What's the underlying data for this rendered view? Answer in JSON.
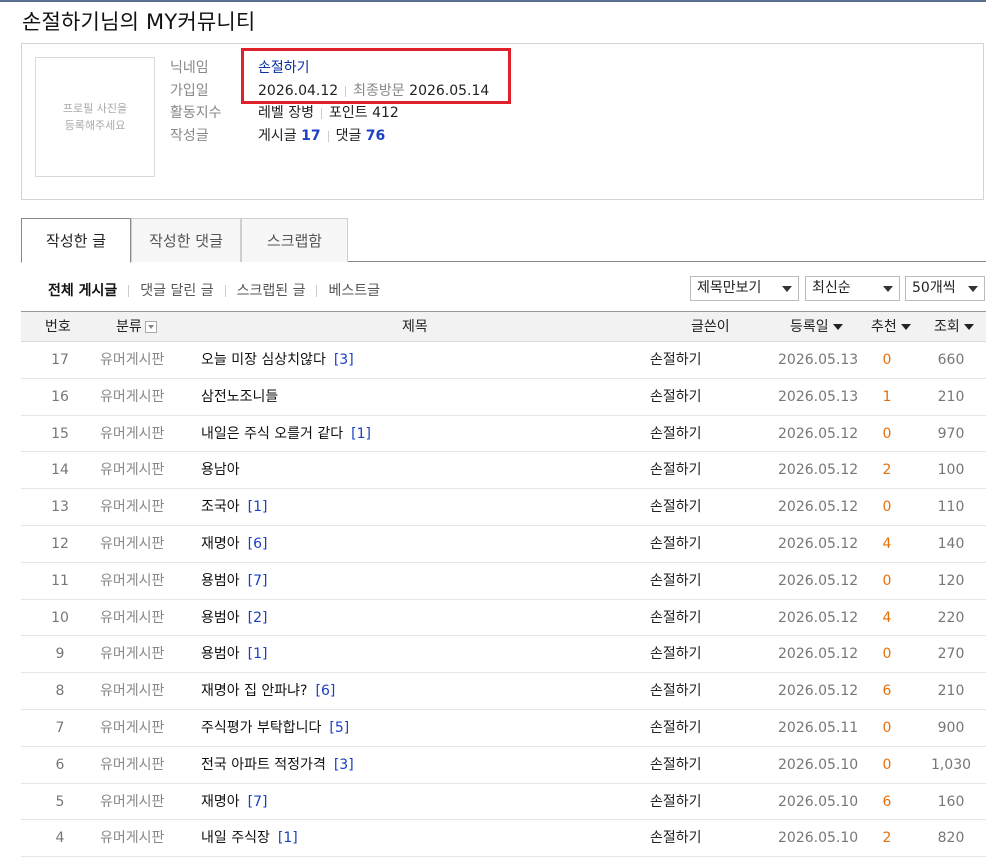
{
  "page": {
    "title": "손절하기님의 MY커뮤니티"
  },
  "profile": {
    "photo_placeholder": "프로필 사진을\n등록해주세요",
    "nickname_label": "닉네임",
    "nickname": "손절하기",
    "join_label": "가입일",
    "join_date": "2026.04.12",
    "last_visit_label": "최종방문",
    "last_visit": "2026.05.14",
    "activity_label": "활동지수",
    "level_text": "레벨 장병",
    "point_label": "포인트",
    "point_value": "412",
    "writings_label": "작성글",
    "posts_label": "게시글",
    "posts_count": "17",
    "comments_label": "댓글",
    "comments_count": "76"
  },
  "tabs": [
    {
      "label": "작성한 글",
      "active": true
    },
    {
      "label": "작성한 댓글",
      "active": false
    },
    {
      "label": "스크랩함",
      "active": false
    }
  ],
  "subnav": [
    {
      "label": "전체 게시글",
      "active": true
    },
    {
      "label": "댓글 달린 글",
      "active": false
    },
    {
      "label": "스크랩된 글",
      "active": false
    },
    {
      "label": "베스트글",
      "active": false
    }
  ],
  "filters": {
    "view_mode": "제목만보기",
    "sort": "최신순",
    "per_page": "50개씩"
  },
  "table": {
    "headers": {
      "no": "번호",
      "category": "분류",
      "title": "제목",
      "author": "글쓴이",
      "date": "등록일",
      "recommend": "추천",
      "views": "조회"
    },
    "rows": [
      {
        "no": "17",
        "category": "유머게시판",
        "title": "오늘 미장 심상치않다",
        "comments": "[3]",
        "author": "손절하기",
        "date": "2026.05.13",
        "recommend": "0",
        "views": "660"
      },
      {
        "no": "16",
        "category": "유머게시판",
        "title": "삼전노조니들",
        "comments": "",
        "author": "손절하기",
        "date": "2026.05.13",
        "recommend": "1",
        "views": "210"
      },
      {
        "no": "15",
        "category": "유머게시판",
        "title": "내일은 주식 오를거 같다",
        "comments": "[1]",
        "author": "손절하기",
        "date": "2026.05.12",
        "recommend": "0",
        "views": "970"
      },
      {
        "no": "14",
        "category": "유머게시판",
        "title": "용남아",
        "comments": "",
        "author": "손절하기",
        "date": "2026.05.12",
        "recommend": "2",
        "views": "100"
      },
      {
        "no": "13",
        "category": "유머게시판",
        "title": "조국아",
        "comments": "[1]",
        "author": "손절하기",
        "date": "2026.05.12",
        "recommend": "0",
        "views": "110"
      },
      {
        "no": "12",
        "category": "유머게시판",
        "title": "재명아",
        "comments": "[6]",
        "author": "손절하기",
        "date": "2026.05.12",
        "recommend": "4",
        "views": "140"
      },
      {
        "no": "11",
        "category": "유머게시판",
        "title": "용범아",
        "comments": "[7]",
        "author": "손절하기",
        "date": "2026.05.12",
        "recommend": "0",
        "views": "120"
      },
      {
        "no": "10",
        "category": "유머게시판",
        "title": "용범아",
        "comments": "[2]",
        "author": "손절하기",
        "date": "2026.05.12",
        "recommend": "4",
        "views": "220"
      },
      {
        "no": "9",
        "category": "유머게시판",
        "title": "용범아",
        "comments": "[1]",
        "author": "손절하기",
        "date": "2026.05.12",
        "recommend": "0",
        "views": "270"
      },
      {
        "no": "8",
        "category": "유머게시판",
        "title": "재명아 집 안파냐?",
        "comments": "[6]",
        "author": "손절하기",
        "date": "2026.05.12",
        "recommend": "6",
        "views": "210"
      },
      {
        "no": "7",
        "category": "유머게시판",
        "title": "주식평가 부탁합니다",
        "comments": "[5]",
        "author": "손절하기",
        "date": "2026.05.11",
        "recommend": "0",
        "views": "900"
      },
      {
        "no": "6",
        "category": "유머게시판",
        "title": "전국 아파트 적정가격",
        "comments": "[3]",
        "author": "손절하기",
        "date": "2026.05.10",
        "recommend": "0",
        "views": "1,030"
      },
      {
        "no": "5",
        "category": "유머게시판",
        "title": "재명아",
        "comments": "[7]",
        "author": "손절하기",
        "date": "2026.05.10",
        "recommend": "6",
        "views": "160"
      },
      {
        "no": "4",
        "category": "유머게시판",
        "title": "내일 주식장",
        "comments": "[1]",
        "author": "손절하기",
        "date": "2026.05.10",
        "recommend": "2",
        "views": "820"
      }
    ]
  },
  "colors": {
    "accent_blue": "#1a3fc2",
    "recommend_orange": "#e5700b",
    "highlight_red": "#e0202a"
  }
}
